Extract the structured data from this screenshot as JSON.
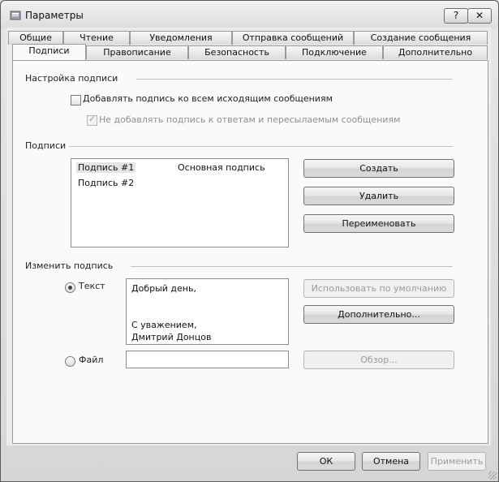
{
  "window": {
    "title": "Параметры",
    "help_label": "?",
    "close_label": "✕"
  },
  "tabs_row1": [
    "Общие",
    "Чтение",
    "Уведомления",
    "Отправка сообщений",
    "Создание сообщения"
  ],
  "tabs_row2": [
    "Подписи",
    "Правописание",
    "Безопасность",
    "Подключение",
    "Дополнительно"
  ],
  "active_tab": "Подписи",
  "settings": {
    "group_title": "Настройка подписи",
    "add_signature_label": "Добавлять подпись ко всем исходящим сообщениям",
    "add_signature_checked": false,
    "no_reply_label": "Не добавлять подпись к ответам и пересылаемым сообщениям",
    "no_reply_checked": true,
    "no_reply_enabled": false
  },
  "signatures": {
    "group_title": "Подписи",
    "items": [
      {
        "name": "Подпись #1",
        "note": "Основная подпись",
        "selected": true
      },
      {
        "name": "Подпись #2",
        "note": "",
        "selected": false
      }
    ],
    "create_label": "Создать",
    "delete_label": "Удалить",
    "rename_label": "Переименовать"
  },
  "edit": {
    "group_title": "Изменить подпись",
    "text_radio_label": "Текст",
    "text_selected": true,
    "signature_text": "Добрый день,\n\n\nС уважением,\nДмитрий Донцов",
    "use_default_label": "Использовать по умолчанию",
    "advanced_label": "Дополнительно...",
    "file_radio_label": "Файл",
    "file_value": "",
    "browse_label": "Обзор..."
  },
  "footer": {
    "ok_label": "ОК",
    "cancel_label": "Отмена",
    "apply_label": "Применить"
  }
}
